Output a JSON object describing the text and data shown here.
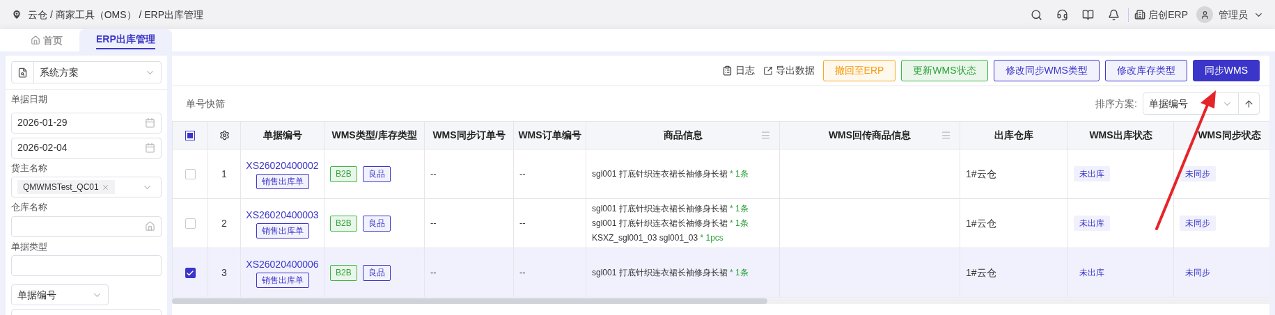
{
  "breadcrumb": "云仓 / 商家工具（OMS） / ERP出库管理",
  "header": {
    "company": "启创ERP",
    "user": "管理员"
  },
  "tabs": [
    {
      "label": "首页",
      "kind": "home",
      "selected": false
    },
    {
      "label": "ERP出库管理",
      "kind": "page",
      "selected": true
    }
  ],
  "filter_panel": {
    "scheme": "系统方案",
    "fields": [
      {
        "kind": "date_range",
        "label": "单据日期",
        "values": [
          "2026-01-29",
          "2026-02-04"
        ]
      },
      {
        "kind": "tag_select",
        "label": "货主名称",
        "tags": [
          "QMWMSTest_QC01"
        ]
      },
      {
        "kind": "warehouse",
        "label": "仓库名称"
      },
      {
        "kind": "text",
        "label": "单据类型"
      },
      {
        "kind": "select_text",
        "select": "单据编号"
      }
    ]
  },
  "toolbar": {
    "links": [
      {
        "label": "日志",
        "kind": "log"
      },
      {
        "label": "导出数据",
        "kind": "export"
      }
    ],
    "buttons": [
      {
        "label": "撤回至ERP",
        "kind": "warning"
      },
      {
        "label": "更新WMS状态",
        "kind": "success"
      },
      {
        "label": "修改同步WMS类型",
        "kind": "outline"
      },
      {
        "label": "修改库存类型",
        "kind": "outline"
      },
      {
        "label": "同步WMS",
        "kind": "primary"
      }
    ]
  },
  "quick_filter": {
    "label": "单号快筛",
    "sort_label": "排序方案:",
    "sort_value": "单据编号"
  },
  "table": {
    "select_all_indeterminate": true,
    "columns": [
      {
        "kind": "select"
      },
      {
        "kind": "settings"
      },
      {
        "kind": "text",
        "label": "单据编号"
      },
      {
        "kind": "text",
        "label": "WMS类型/库存类型"
      },
      {
        "kind": "text",
        "label": "WMS同步订单号"
      },
      {
        "kind": "text",
        "label": "WMS订单编号"
      },
      {
        "kind": "text",
        "label": "商品信息",
        "menu": true
      },
      {
        "kind": "text",
        "label": "WMS回传商品信息",
        "menu": true
      },
      {
        "kind": "text",
        "label": "出库仓库"
      },
      {
        "kind": "text",
        "label": "WMS出库状态"
      },
      {
        "kind": "text",
        "label": "WMS同步状态"
      }
    ],
    "rows": [
      {
        "index": "1",
        "selected": false,
        "order_no": "XS26020400002",
        "order_type": "销售出库单",
        "wms_type": "B2B",
        "stock_type": "良品",
        "wms_sync_no": "--",
        "wms_order_no": "--",
        "goods": [
          {
            "name": "sgl001 打底针织连衣裙长袖修身长裙",
            "qty": "* 1条"
          }
        ],
        "warehouse": "1#云仓",
        "out_status": "未出库",
        "sync_status": "未同步"
      },
      {
        "index": "2",
        "selected": false,
        "order_no": "XS26020400003",
        "order_type": "销售出库单",
        "wms_type": "B2B",
        "stock_type": "良品",
        "wms_sync_no": "--",
        "wms_order_no": "--",
        "goods": [
          {
            "name": "sgl001 打底针织连衣裙长袖修身长裙",
            "qty": "* 1条"
          },
          {
            "name": "sgl001 打底针织连衣裙长袖修身长裙",
            "qty": "* 1条"
          },
          {
            "name": "KSXZ_sgl001_03 sgl001_03",
            "qty": "* 1pcs"
          }
        ],
        "warehouse": "1#云仓",
        "out_status": "未出库",
        "sync_status": "未同步"
      },
      {
        "index": "3",
        "selected": true,
        "order_no": "XS26020400006",
        "order_type": "销售出库单",
        "wms_type": "B2B",
        "stock_type": "良品",
        "wms_sync_no": "--",
        "wms_order_no": "--",
        "goods": [
          {
            "name": "sgl001 打底针织连衣裙长袖修身长裙",
            "qty": "* 1条"
          }
        ],
        "warehouse": "1#云仓",
        "out_status": "未出库",
        "sync_status": "未同步"
      }
    ]
  }
}
